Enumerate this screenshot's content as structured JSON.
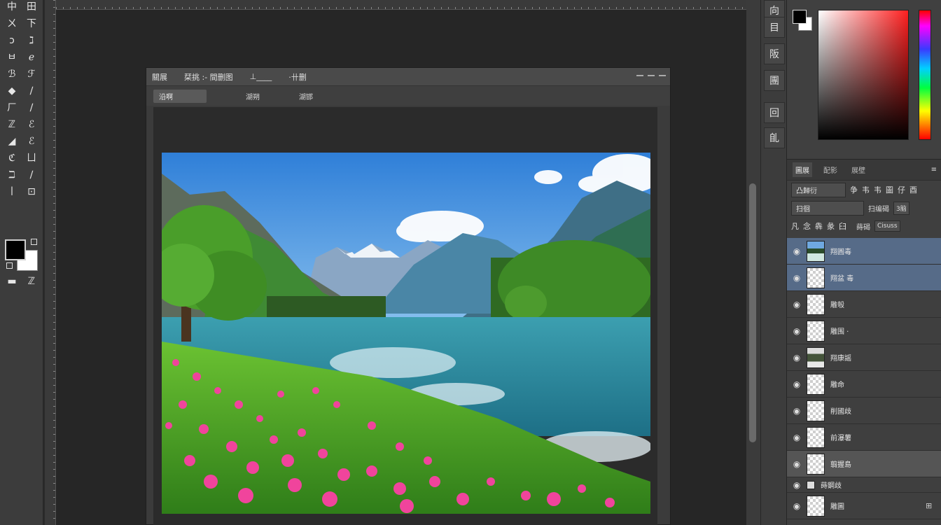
{
  "toolbar": {
    "tools": [
      {
        "name": "move-tool",
        "glyph": "中"
      },
      {
        "name": "artboard-tool",
        "glyph": "田"
      },
      {
        "name": "marquee-tool",
        "glyph": "ㄨ"
      },
      {
        "name": "lasso-tool",
        "glyph": "下"
      },
      {
        "name": "quick-select-tool",
        "glyph": "ɔ"
      },
      {
        "name": "crop-tool",
        "glyph": "ℷ"
      },
      {
        "name": "eyedropper-tool",
        "glyph": "ㅂ"
      },
      {
        "name": "healing-tool",
        "glyph": "ℯ"
      },
      {
        "name": "brush-tool",
        "glyph": "ℬ"
      },
      {
        "name": "clone-stamp-tool",
        "glyph": "ℱ"
      },
      {
        "name": "history-brush-tool",
        "glyph": "◆"
      },
      {
        "name": "eraser-tool",
        "glyph": "∕"
      },
      {
        "name": "gradient-tool",
        "glyph": "ㄏ"
      },
      {
        "name": "blur-tool",
        "glyph": "∕"
      },
      {
        "name": "dodge-tool",
        "glyph": "ℤ"
      },
      {
        "name": "pen-tool",
        "glyph": "ℰ"
      },
      {
        "name": "type-tool",
        "glyph": "◢"
      },
      {
        "name": "path-select-tool",
        "glyph": "ℰ"
      },
      {
        "name": "shape-tool",
        "glyph": "ℭ"
      },
      {
        "name": "hand-tool",
        "glyph": "ㄩ"
      },
      {
        "name": "zoom-tool",
        "glyph": "ℶ"
      },
      {
        "name": "extra-tool",
        "glyph": "∕"
      },
      {
        "name": "edit-toolbar",
        "glyph": "ㅣ"
      },
      {
        "name": "quick-mask",
        "glyph": "⊡"
      }
    ],
    "bottom": [
      {
        "name": "screen-mode",
        "glyph": "▬"
      },
      {
        "name": "quick-mask-toggle",
        "glyph": "ℤ"
      }
    ]
  },
  "document": {
    "tab_title": "關展",
    "tab_doc": "栞挑 :- 間删图",
    "tab_extra1": "⊥____",
    "tab_extra2": "·卄删",
    "opt_box": "沿啊",
    "opt_label1": "湖朔",
    "opt_label2": "湖邯"
  },
  "panel_icons": [
    "向",
    "目",
    "阪",
    "團",
    "回",
    "臫"
  ],
  "layers_panel": {
    "tabs": [
      "圖展",
      "配影",
      "展壁"
    ],
    "row1_select": "凸歸衍",
    "row1_icons": [
      "争",
      "韦",
      "韦",
      "圖",
      "仔",
      "酉"
    ],
    "row2_select": "扫徊",
    "row2_label": "扫编碣",
    "row2_value": "3脑",
    "row3_icons": [
      "凡",
      "念",
      "犇",
      "彖",
      "臼"
    ],
    "row3_label": "蒔碣",
    "row3_value": "Cisuss",
    "layers": [
      {
        "name": "翔圓毒",
        "thumb": "img",
        "state": "sel",
        "eye": "👁",
        "extra": ""
      },
      {
        "name": "翔盆 毒",
        "thumb": "trans",
        "state": "sel",
        "eye": "👁",
        "extra": ""
      },
      {
        "name": "雕彀",
        "thumb": "trans",
        "state": "",
        "eye": "👁",
        "extra": ""
      },
      {
        "name": "雕围 ·",
        "thumb": "trans",
        "state": "",
        "eye": "👁",
        "extra": ""
      },
      {
        "name": "翔康謡",
        "thumb": "img2",
        "state": "",
        "eye": "👁",
        "extra": ""
      },
      {
        "name": "雕命",
        "thumb": "trans",
        "state": "",
        "eye": "👁",
        "extra": ""
      },
      {
        "name": "削國歧",
        "thumb": "trans",
        "state": "",
        "eye": "👁",
        "extra": ""
      },
      {
        "name": "前瀑薯",
        "thumb": "trans",
        "state": "",
        "eye": "👁",
        "extra": ""
      },
      {
        "name": "翦握島",
        "thumb": "trans",
        "state": "hl",
        "eye": "👁",
        "extra": ""
      },
      {
        "name": "蒔鋼歧",
        "thumb": "folder",
        "state": "short",
        "eye": "👁",
        "extra": ""
      },
      {
        "name": "雕圖",
        "thumb": "trans",
        "state": "",
        "eye": "👁",
        "extra": "⊞"
      }
    ]
  },
  "colors": {
    "accent_selected_layer": "#566b88",
    "foreground": "#000000",
    "background": "#ffffff"
  }
}
